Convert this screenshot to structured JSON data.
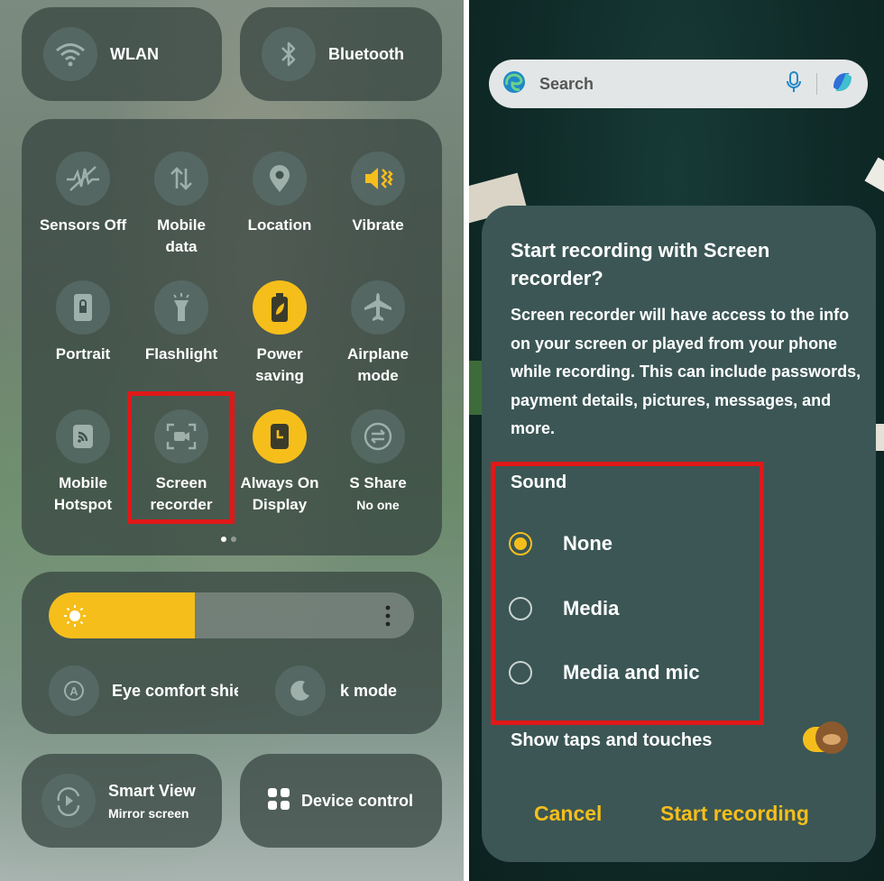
{
  "quick_panel": {
    "wlan": {
      "label": "WLAN",
      "icon": "wifi-icon"
    },
    "bluetooth": {
      "label": "Bluetooth",
      "icon": "bluetooth-icon"
    },
    "tiles": [
      {
        "line1": "Sensors Off",
        "line2": "",
        "icon": "sensors-off-icon"
      },
      {
        "line1": "Mobile",
        "line2": "data",
        "icon": "mobile-data-icon"
      },
      {
        "line1": "Location",
        "line2": "",
        "icon": "location-icon"
      },
      {
        "line1": "Vibrate",
        "line2": "",
        "icon": "vibrate-icon"
      },
      {
        "line1": "Portrait",
        "line2": "",
        "icon": "portrait-lock-icon"
      },
      {
        "line1": "Flashlight",
        "line2": "",
        "icon": "flashlight-icon"
      },
      {
        "line1": "Power",
        "line2": "saving",
        "icon": "power-saving-icon"
      },
      {
        "line1": "Airplane",
        "line2": "mode",
        "icon": "airplane-icon"
      },
      {
        "line1": "Mobile",
        "line2": "Hotspot",
        "icon": "hotspot-icon"
      },
      {
        "line1": "Screen",
        "line2": "recorder",
        "icon": "screen-recorder-icon"
      },
      {
        "line1": "Always On",
        "line2": "Display",
        "icon": "always-on-display-icon"
      },
      {
        "line1": "S Share",
        "line2": "No one",
        "icon": "s-share-icon"
      }
    ],
    "brightness": {
      "level": 0.4
    },
    "eye_comfort_label": "Eye comfort shie",
    "dark_mode_label": "k mode",
    "smart_view": {
      "title": "Smart View",
      "subtitle": "Mirror screen"
    },
    "device_control": {
      "label": "Device control"
    },
    "accent_color": "#f6be1b"
  },
  "search_bar": {
    "placeholder": "Search"
  },
  "dialog": {
    "title": "Start recording with Screen recorder?",
    "body": "Screen recorder will have access to the info on your screen or played from your phone while recording. This can include passwords, payment details, pictures, messages, and more.",
    "sound_label": "Sound",
    "options": [
      {
        "label": "None",
        "selected": true
      },
      {
        "label": "Media",
        "selected": false
      },
      {
        "label": "Media and mic",
        "selected": false
      }
    ],
    "show_taps_label": "Show taps and touches",
    "cancel_label": "Cancel",
    "start_label": "Start recording"
  }
}
